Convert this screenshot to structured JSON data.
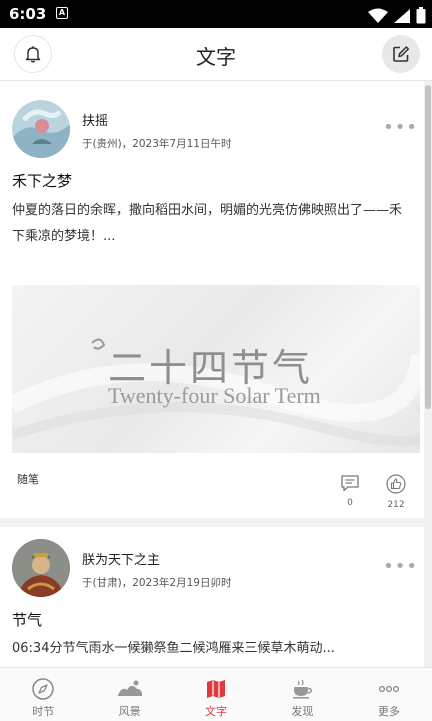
{
  "status_bar": {
    "time": "6:03",
    "app_icon_letter": "A"
  },
  "header": {
    "title": "文字",
    "left_icon": "bell-icon",
    "right_icon": "edit-icon"
  },
  "posts": [
    {
      "author": "扶摇",
      "meta": "于(贵州)，2023年7月11日午时",
      "title": "禾下之梦",
      "excerpt": "仲夏的落日的余晖，撒向稻田水间，明媚的光亮仿佛映照出了——禾下乘凉的梦境！...",
      "cover_title_cn": "二十四节气",
      "cover_title_en": "Twenty-four Solar Term",
      "tag": "随笔",
      "comments": "0",
      "likes": "212"
    },
    {
      "author": "朕为天下之主",
      "meta": "于(甘肃)，2023年2月19日卯时",
      "title": "节气",
      "excerpt": "06:34分节气雨水一候獭祭鱼二候鸿雁来三候草木萌动..."
    }
  ],
  "bottom_nav": [
    {
      "label": "时节",
      "icon": "compass-icon",
      "active": false
    },
    {
      "label": "风景",
      "icon": "landscape-icon",
      "active": false
    },
    {
      "label": "文字",
      "icon": "map-icon",
      "active": true
    },
    {
      "label": "发现",
      "icon": "tea-cup-icon",
      "active": false
    },
    {
      "label": "更多",
      "icon": "more-dots-icon",
      "active": false
    }
  ],
  "colors": {
    "accent": "#e0393e",
    "divider": "#f3f3f3",
    "status_bar": "#000000"
  }
}
